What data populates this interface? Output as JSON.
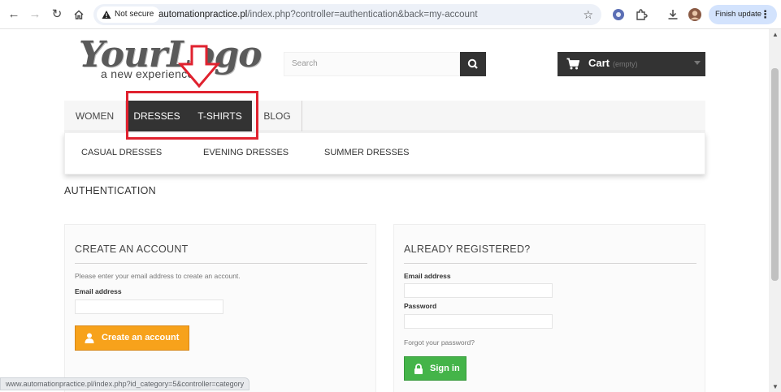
{
  "browser": {
    "security_label": "Not secure",
    "url_host": "automationpractice.pl",
    "url_path": "/index.php?controller=authentication&back=my-account",
    "update_label": "Finish update",
    "status_url": "www.automationpractice.pl/index.php?id_category=5&controller=category"
  },
  "header": {
    "logo_main": "YourLogo",
    "logo_sub": "a new experience",
    "search_placeholder": "Search",
    "cart_label": "Cart",
    "cart_status": "(empty)"
  },
  "menu": {
    "items": [
      {
        "label": "WOMEN"
      },
      {
        "label": "DRESSES"
      },
      {
        "label": "T-SHIRTS"
      },
      {
        "label": "BLOG"
      }
    ],
    "submenu": [
      {
        "label": "CASUAL DRESSES"
      },
      {
        "label": "EVENING DRESSES"
      },
      {
        "label": "SUMMER DRESSES"
      }
    ]
  },
  "page": {
    "heading": "AUTHENTICATION"
  },
  "create_account": {
    "title": "CREATE AN ACCOUNT",
    "help": "Please enter your email address to create an account.",
    "email_label": "Email address",
    "email_value": "",
    "button_label": "Create an account"
  },
  "login": {
    "title": "ALREADY REGISTERED?",
    "email_label": "Email address",
    "email_value": "",
    "password_label": "Password",
    "password_value": "",
    "forgot_label": "Forgot your password?",
    "button_label": "Sign in"
  },
  "colors": {
    "annotation": "#e0222f",
    "dark": "#333333",
    "orange": "#f7a21b",
    "green": "#44b449"
  }
}
